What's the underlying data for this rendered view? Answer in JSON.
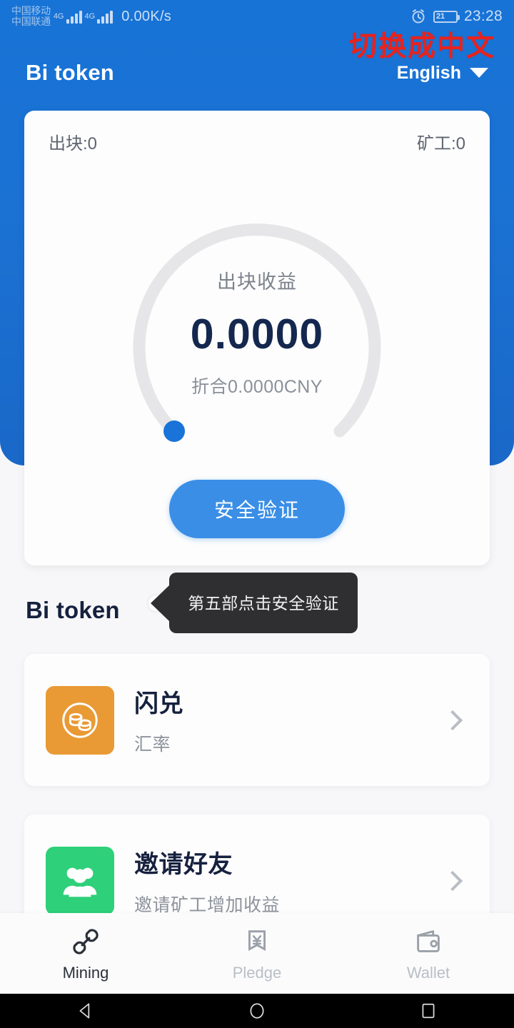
{
  "statusbar": {
    "carrier_line1": "中国移动",
    "carrier_line2": "中国联通",
    "network_type": "4G",
    "net_speed": "0.00K/s",
    "battery_percent": "21",
    "time": "23:28",
    "alarm_icon": "alarm-clock-icon"
  },
  "header": {
    "app_title": "Bi token",
    "language": "English",
    "annotation": "切换成中文",
    "annotation_color": "#e8231d",
    "brand_blue": "#1773d6"
  },
  "maincard": {
    "blocks_label": "出块:0",
    "miners_label": "矿工:0",
    "gauge": {
      "label": "出块收益",
      "value": "0.0000",
      "sub": "折合0.0000CNY",
      "percent": 0,
      "track_color": "#e6e6e8",
      "marker_color": "#1a73d8"
    },
    "verify_button": "安全验证",
    "verify_button_color": "#3a8ee6"
  },
  "tooltip": {
    "text": "第五部点击安全验证",
    "background": "#2f2f31"
  },
  "section": {
    "title": "Bi token"
  },
  "list": [
    {
      "id": "swap",
      "title": "闪兑",
      "sub": "汇率",
      "icon": "coins-icon",
      "icon_color": "#e99a35"
    },
    {
      "id": "invite",
      "title": "邀请好友",
      "sub": "邀请矿工增加收益",
      "icon": "people-icon",
      "icon_color": "#2ed07a"
    }
  ],
  "bottomnav": [
    {
      "label": "Mining",
      "icon": "chain-link-icon",
      "active": true
    },
    {
      "label": "Pledge",
      "icon": "yen-banner-icon",
      "active": false
    },
    {
      "label": "Wallet",
      "icon": "wallet-icon",
      "active": false
    }
  ],
  "androidnav": {
    "back": "back-triangle-icon",
    "home": "home-circle-icon",
    "recents": "recents-square-icon"
  }
}
